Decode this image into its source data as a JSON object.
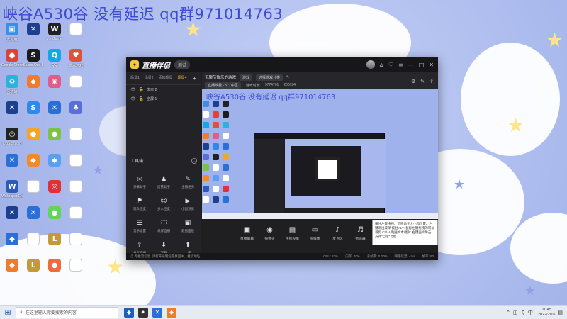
{
  "overlay_text": "峡谷A530谷 没有延迟 qq群971014763",
  "desktop_icons": [
    {
      "label": "此电脑",
      "color": "#3a8ee6",
      "glyph": "▣"
    },
    {
      "label": "",
      "color": "#1d3f8f",
      "glyph": "✕"
    },
    {
      "label": "WeGame",
      "color": "#222222",
      "glyph": "W"
    },
    {
      "label": "",
      "color": "#ffffff",
      "glyph": ""
    },
    {
      "label": "Google Chrome",
      "color": "#db4437",
      "glyph": "●"
    },
    {
      "label": "Studio One 5",
      "color": "#1b1b1b",
      "glyph": "S"
    },
    {
      "label": "QQ",
      "color": "#12a7e6",
      "glyph": "Q"
    },
    {
      "label": "爱人游戏",
      "color": "#e0503a",
      "glyph": "♥"
    },
    {
      "label": "回收站",
      "color": "#2bb3d9",
      "glyph": "♻"
    },
    {
      "label": "",
      "color": "#f07c2b",
      "glyph": "◆"
    },
    {
      "label": "",
      "color": "#e25c8a",
      "glyph": "◉"
    },
    {
      "label": "",
      "color": "#ffffff",
      "glyph": ""
    },
    {
      "label": "",
      "color": "#1d3f8f",
      "glyph": "✕"
    },
    {
      "label": "",
      "color": "#2e8ae6",
      "glyph": "S"
    },
    {
      "label": "",
      "color": "#2a6fd6",
      "glyph": "✕"
    },
    {
      "label": "",
      "color": "#5a6fd6",
      "glyph": "♣"
    },
    {
      "label": "OBS Studio",
      "color": "#222222",
      "glyph": "◎"
    },
    {
      "label": "",
      "color": "#f5a524",
      "glyph": "●"
    },
    {
      "label": "",
      "color": "#7cc243",
      "glyph": "●"
    },
    {
      "label": "",
      "color": "#ffffff",
      "glyph": ""
    },
    {
      "label": "",
      "color": "#2a6fd6",
      "glyph": "✕"
    },
    {
      "label": "",
      "color": "#f58a24",
      "glyph": "◆"
    },
    {
      "label": "",
      "color": "#5a9ff0",
      "glyph": "◆"
    },
    {
      "label": "",
      "color": "#ffffff",
      "glyph": ""
    },
    {
      "label": "Wallpaper Engine",
      "color": "#2a5bb8",
      "glyph": "W"
    },
    {
      "label": "",
      "color": "#ffffff",
      "glyph": "⚙"
    },
    {
      "label": "",
      "color": "#e0303a",
      "glyph": "◎"
    },
    {
      "label": "",
      "color": "#ffffff",
      "glyph": ""
    },
    {
      "label": "",
      "color": "#1d3f8f",
      "glyph": "✕"
    },
    {
      "label": "",
      "color": "#2a6fd6",
      "glyph": "✕"
    },
    {
      "label": "",
      "color": "#5fd65a",
      "glyph": "●"
    },
    {
      "label": "",
      "color": "#ffffff",
      "glyph": ""
    },
    {
      "label": "",
      "color": "#2a6fd6",
      "glyph": "◆"
    },
    {
      "label": "",
      "color": "#ffffff",
      "glyph": ""
    },
    {
      "label": "",
      "color": "#c29a3a",
      "glyph": "L"
    },
    {
      "label": "",
      "color": "#ffffff",
      "glyph": ""
    },
    {
      "label": "",
      "color": "#f07c2b",
      "glyph": "◆"
    },
    {
      "label": "",
      "color": "#c29a3a",
      "glyph": "L"
    },
    {
      "label": "",
      "color": "#f06a3a",
      "glyph": "●"
    },
    {
      "label": "",
      "color": "#ffffff",
      "glyph": ""
    }
  ],
  "window": {
    "logo_glyph": "✦",
    "logo_text": "直播伴侣",
    "version_badge": "测试",
    "title_buttons": [
      "⌂",
      "♡",
      "≡",
      "—",
      "□",
      "✕"
    ],
    "scene_tabs": [
      "场景1",
      "场景2",
      "添加场景",
      "场景4"
    ],
    "add_scene": "+",
    "sources": [
      {
        "label": "文本 2",
        "eye": "👁",
        "lock": "🔒"
      },
      {
        "label": "全屏 1",
        "eye": "👁",
        "lock": "🔒"
      }
    ],
    "toolbox_title": "工具箱",
    "toolbox_more": "…",
    "tools": [
      {
        "icon": "◎",
        "label": "弹幕助手"
      },
      {
        "icon": "♟",
        "label": "房管助手"
      },
      {
        "icon": "✎",
        "label": "主播任务"
      },
      {
        "icon": "⚑",
        "label": "观众连麦"
      },
      {
        "icon": "☺",
        "label": "多人连麦"
      },
      {
        "icon": "▶",
        "label": "小窗预览"
      },
      {
        "icon": "☰",
        "label": "音乐设置"
      },
      {
        "icon": "⬚",
        "label": "录屏直播"
      },
      {
        "icon": "▣",
        "label": "数据面板"
      },
      {
        "icon": "⇪",
        "label": "分享直播"
      },
      {
        "icon": "⬇",
        "label": "下载"
      },
      {
        "icon": "⬆",
        "label": "上传"
      }
    ],
    "live": {
      "title": "无聊节快乐的游戏",
      "tag": "游戏",
      "category": "选择游戏分类",
      "edit_icon": "✎",
      "stats": [
        "直播数量 - 571中区",
        "游戏时长",
        "9774701",
        "200194"
      ],
      "right_icons": [
        "⚙",
        "✎",
        "⇪"
      ]
    },
    "preview_text": "峡谷A530谷 没有延迟 qq群971014763",
    "controls": [
      {
        "icon": "▣",
        "label": "直播屏幕"
      },
      {
        "icon": "◉",
        "label": "摄像头"
      },
      {
        "icon": "▤",
        "label": "手机投屏"
      },
      {
        "icon": "▭",
        "label": "多媒体"
      },
      {
        "icon": "♪",
        "label": "麦克风"
      },
      {
        "icon": "♬",
        "label": "扬声器"
      }
    ],
    "status_left": "⚠ 无推流信息 ,请打开录制设置界面中，推流地址",
    "status_right": [
      "CPU: 23%",
      "内存: 40%",
      "丢帧率: 0.00%",
      "网络延迟: 4ms",
      "帧率: 60"
    ]
  },
  "tooltip": "按住左键拖拽、可移动至大小和位置、右键滑出菜单 按住ALT+鼠标左键拖拽的可以裁剪 Ctrl+V粘贴文本/图片 右键画片单击，支持\"自定\"功能",
  "taskbar": {
    "start_icon": "⊞",
    "search_icon": "⌕",
    "search_placeholder": "在这里输入你要搜索的内容",
    "apps": [
      {
        "glyph": "◆",
        "color": "#1b5fb8"
      },
      {
        "glyph": "✦",
        "color": "#333333"
      },
      {
        "glyph": "✕",
        "color": "#2a6fd6"
      },
      {
        "glyph": "◆",
        "color": "#f07c2b"
      }
    ],
    "tray_symbols": [
      "⌃",
      "◫",
      "♫",
      "中"
    ],
    "time": "11:45",
    "date": "2022/2/16",
    "notification_icon": "▤"
  }
}
